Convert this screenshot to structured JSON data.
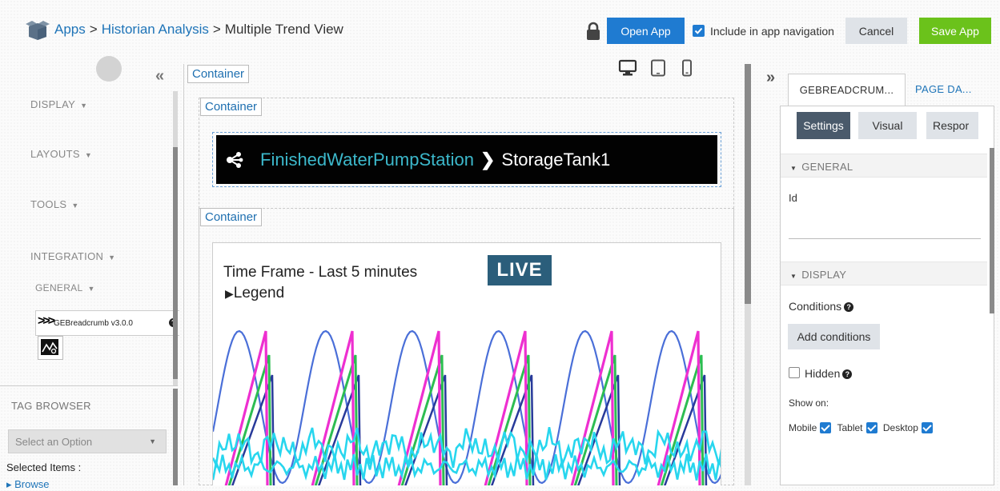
{
  "header": {
    "breadcrumb": {
      "apps": "Apps",
      "app": "Historian Analysis",
      "page": "Multiple Trend View",
      "separator": ">"
    },
    "open_app": "Open App",
    "include_nav_label": "Include in app navigation",
    "include_nav_checked": true,
    "cancel": "Cancel",
    "save_app": "Save App"
  },
  "sidebar": {
    "collapse_glyph": "«",
    "sections": [
      "DISPLAY",
      "LAYOUTS",
      "TOOLS",
      "INTEGRATION"
    ],
    "general_label": "GENERAL",
    "widget_label": "GEBreadcrumb v3.0.0",
    "tag_browser": {
      "title": "TAG BROWSER",
      "select_placeholder": "Select an Option",
      "selected_items_label": "Selected Items :",
      "browse_label": "Browse"
    }
  },
  "canvas": {
    "container_label": "Container",
    "breadcrumb_widget": {
      "link": "FinishedWaterPumpStation",
      "current": "StorageTank1"
    },
    "trend": {
      "time_frame": "Time Frame -  Last 5 minutes",
      "live_badge": "LIVE",
      "legend_label": "Legend",
      "series_colors": {
        "blue": "#4a6fd8",
        "magenta": "#ee2fd0",
        "green": "#2dbd52",
        "navy": "#283a9a",
        "cyan": "#27d6ee"
      }
    }
  },
  "right_panel": {
    "expand_glyph": "»",
    "tabs": [
      "GEBREADCRUM...",
      "PAGE DA..."
    ],
    "sub_tabs": [
      "Settings",
      "Visual",
      "Respor"
    ],
    "general": {
      "title": "GENERAL",
      "id_label": "Id",
      "id_value": ""
    },
    "display": {
      "title": "DISPLAY",
      "conditions_label": "Conditions",
      "add_conditions": "Add conditions",
      "hidden_label": "Hidden",
      "hidden_checked": false,
      "show_on_label": "Show on:",
      "devices": [
        {
          "label": "Mobile",
          "checked": true
        },
        {
          "label": "Tablet",
          "checked": true
        },
        {
          "label": "Desktop",
          "checked": true
        }
      ]
    }
  },
  "colors": {
    "primary_blue": "#1f7bd1",
    "save_green": "#6bc21b",
    "link_blue": "#1e74b8",
    "live_badge": "#2b5e7b"
  }
}
